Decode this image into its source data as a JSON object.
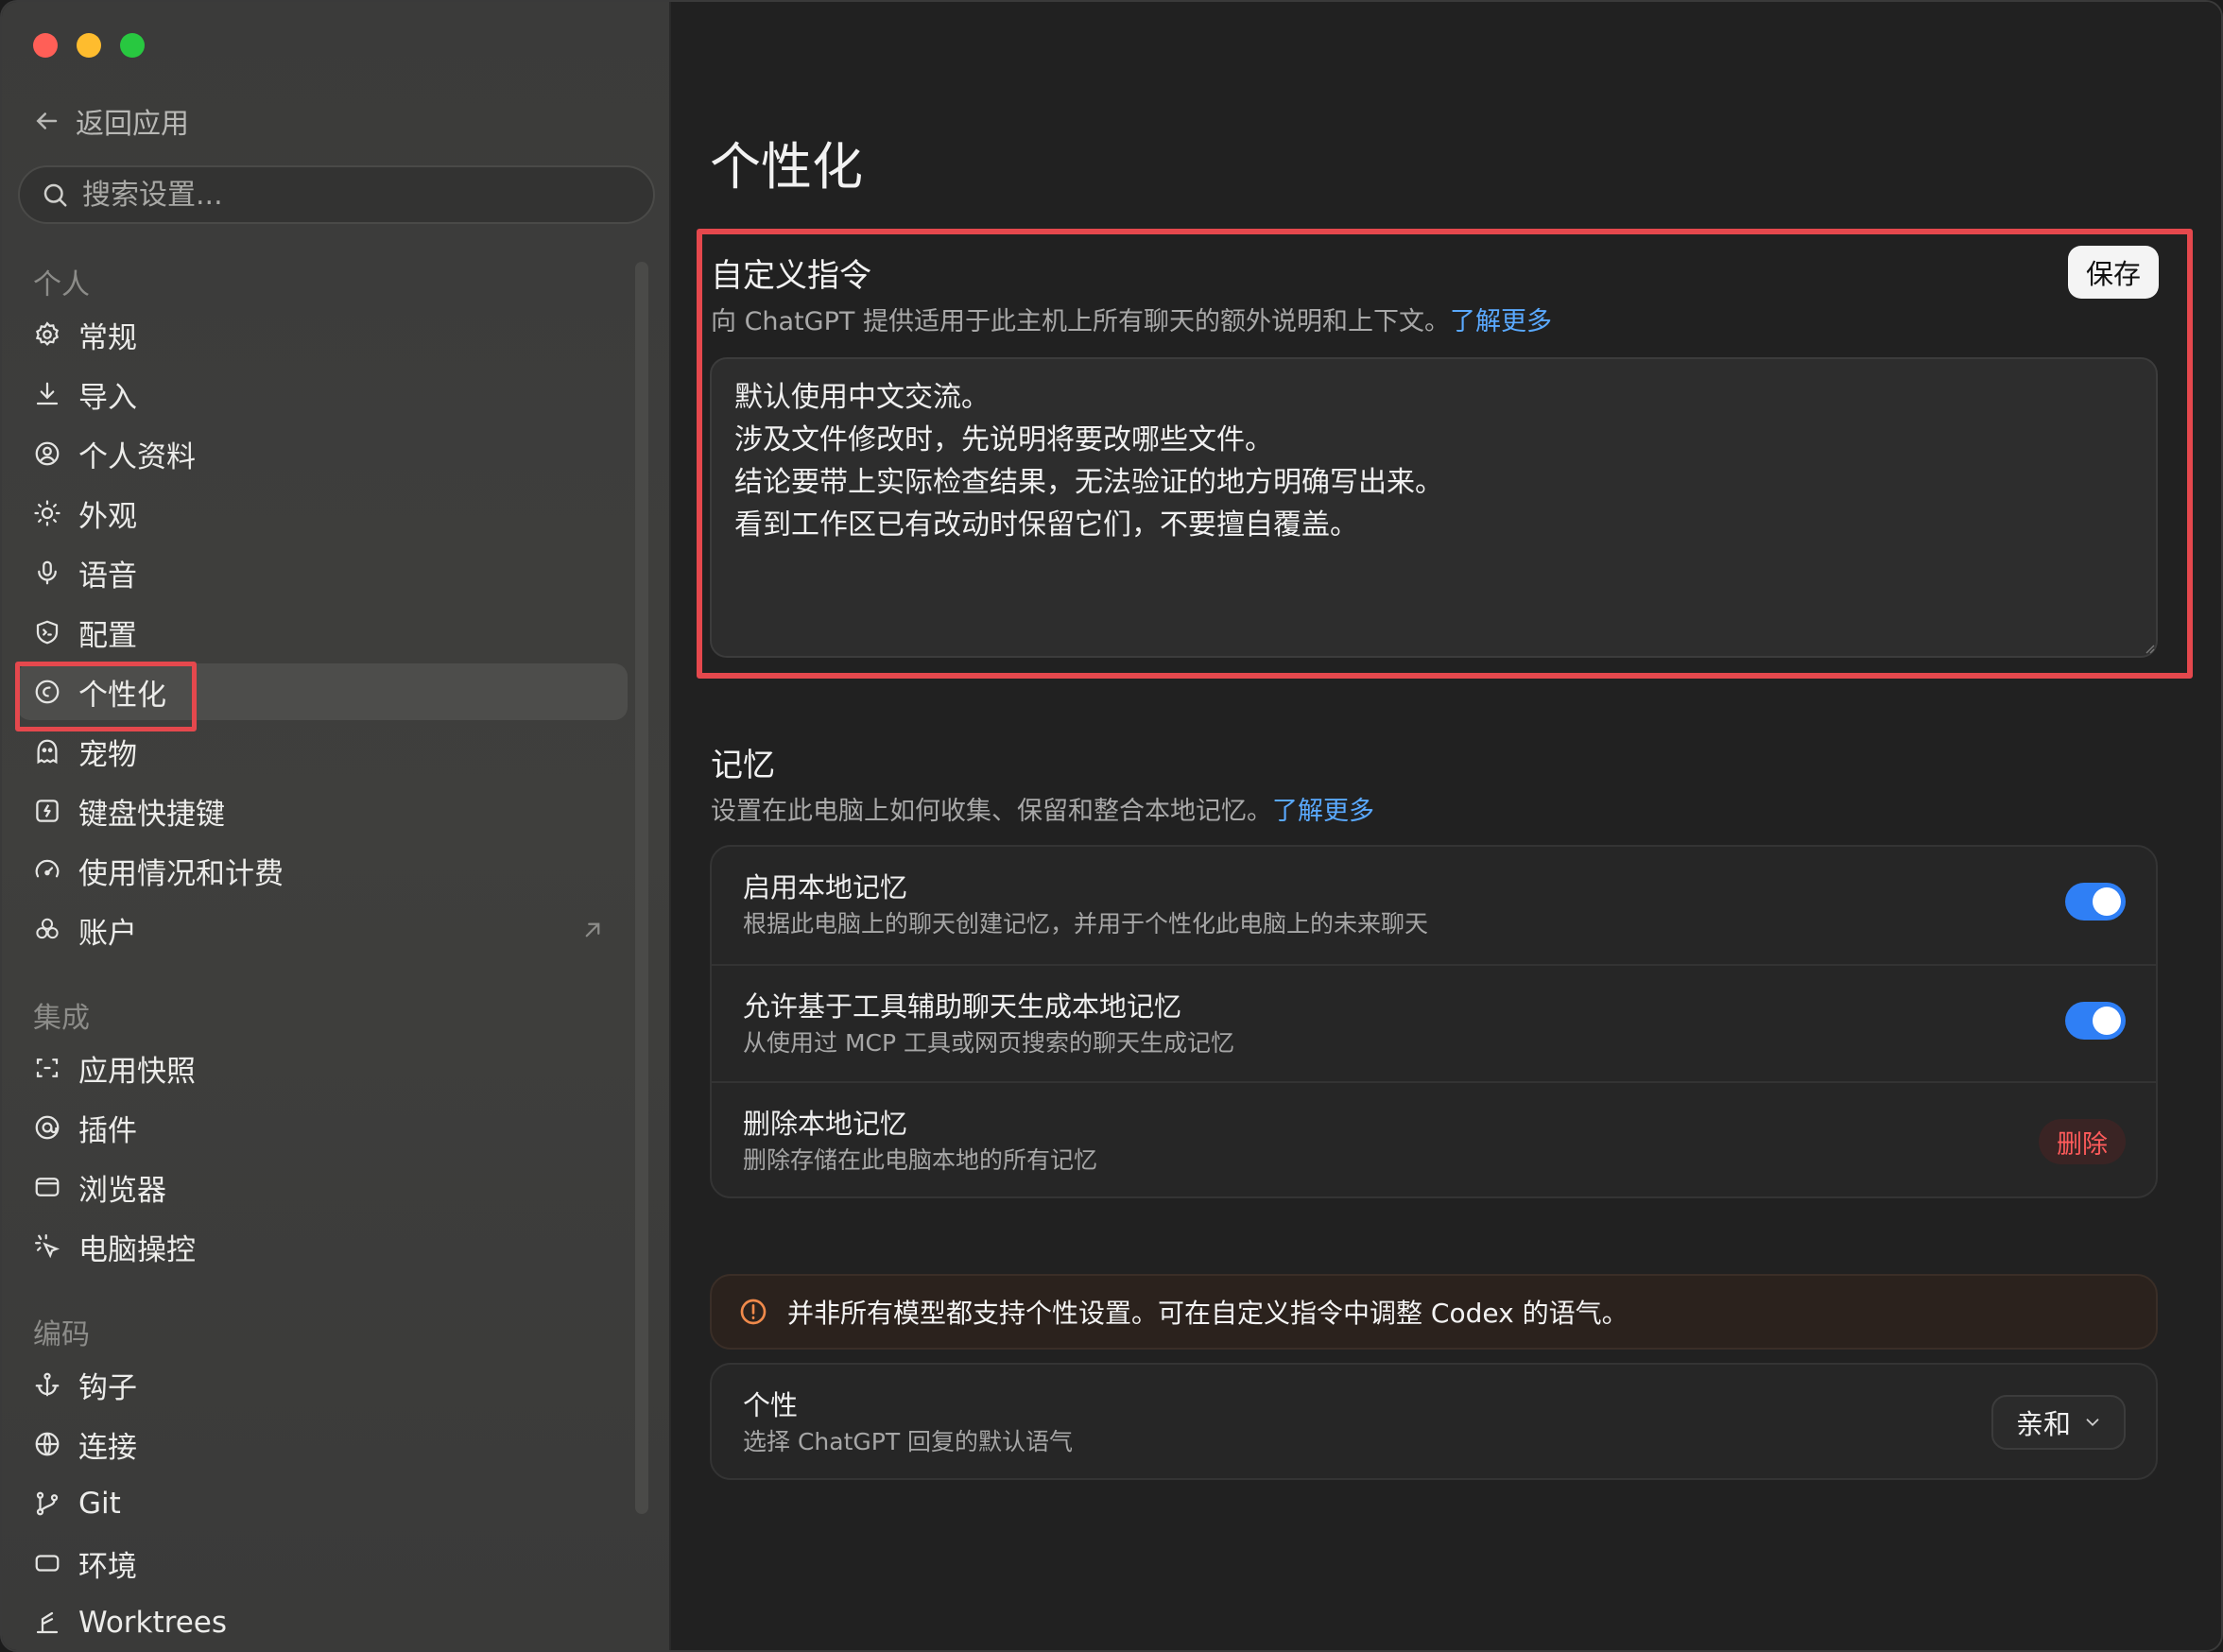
{
  "window": {
    "traffic_lights": [
      "close",
      "minimize",
      "zoom"
    ]
  },
  "sidebar": {
    "back_label": "返回应用",
    "search_placeholder": "搜索设置...",
    "sections": [
      {
        "title": "个人",
        "items": [
          {
            "label": "常规",
            "icon": "gear-icon"
          },
          {
            "label": "导入",
            "icon": "download-icon"
          },
          {
            "label": "个人资料",
            "icon": "user-circle-icon"
          },
          {
            "label": "外观",
            "icon": "sun-icon"
          },
          {
            "label": "语音",
            "icon": "microphone-icon"
          },
          {
            "label": "配置",
            "icon": "shield-icon"
          },
          {
            "label": "个性化",
            "icon": "personalization-icon",
            "active": true
          },
          {
            "label": "宠物",
            "icon": "pet-icon"
          },
          {
            "label": "键盘快捷键",
            "icon": "keyboard-icon"
          },
          {
            "label": "使用情况和计费",
            "icon": "gauge-icon"
          },
          {
            "label": "账户",
            "icon": "openai-icon",
            "external": true
          }
        ]
      },
      {
        "title": "集成",
        "items": [
          {
            "label": "应用快照",
            "icon": "screenshot-icon"
          },
          {
            "label": "插件",
            "icon": "plugin-icon"
          },
          {
            "label": "浏览器",
            "icon": "browser-icon"
          },
          {
            "label": "电脑操控",
            "icon": "cursor-click-icon"
          }
        ]
      },
      {
        "title": "编码",
        "items": [
          {
            "label": "钩子",
            "icon": "anchor-icon"
          },
          {
            "label": "连接",
            "icon": "globe-icon"
          },
          {
            "label": "Git",
            "icon": "git-branch-icon"
          },
          {
            "label": "环境",
            "icon": "environment-icon"
          },
          {
            "label": "Worktrees",
            "icon": "worktree-icon"
          }
        ]
      }
    ]
  },
  "main": {
    "title": "个性化",
    "custom_instructions": {
      "title": "自定义指令",
      "description": "向 ChatGPT 提供适用于此主机上所有聊天的额外说明和上下文。",
      "learn_more": "了解更多",
      "save_label": "保存",
      "text": "默认使用中文交流。\n涉及文件修改时，先说明将要改哪些文件。\n结论要带上实际检查结果，无法验证的地方明确写出来。\n看到工作区已有改动时保留它们，不要擅自覆盖。"
    },
    "memory": {
      "title": "记忆",
      "description": "设置在此电脑上如何收集、保留和整合本地记忆。",
      "learn_more": "了解更多",
      "rows": [
        {
          "title": "启用本地记忆",
          "subtitle": "根据此电脑上的聊天创建记忆，并用于个性化此电脑上的未来聊天",
          "enabled": true
        },
        {
          "title": "允许基于工具辅助聊天生成本地记忆",
          "subtitle": "从使用过 MCP 工具或网页搜索的聊天生成记忆",
          "enabled": true
        },
        {
          "title": "删除本地记忆",
          "subtitle": "删除存储在此电脑本地的所有记忆",
          "action_label": "删除"
        }
      ]
    },
    "warning": {
      "text": "并非所有模型都支持个性设置。可在自定义指令中调整 Codex 的语气。",
      "icon": "alert-circle-icon"
    },
    "personality": {
      "title": "个性",
      "subtitle": "选择 ChatGPT 回复的默认语气",
      "selected": "亲和"
    }
  },
  "colors": {
    "accent": "#2f7ff5",
    "highlight": "#e5484d",
    "link": "#5aa9ff",
    "danger": "#ff5b5b"
  }
}
